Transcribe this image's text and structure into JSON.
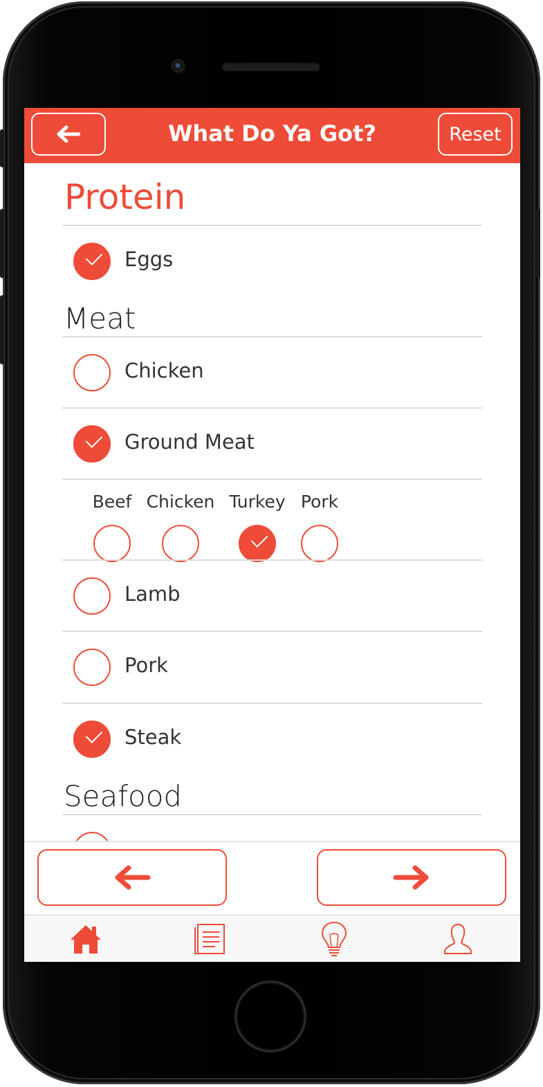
{
  "header": {
    "title": "What Do Ya Got?",
    "back_icon": "arrow-left-icon",
    "reset_label": "Reset"
  },
  "section": {
    "title": "Protein"
  },
  "items": {
    "eggs": {
      "label": "Eggs",
      "checked": true
    }
  },
  "meat": {
    "title": "Meat",
    "items": [
      {
        "label": "Chicken",
        "checked": false
      },
      {
        "label": "Ground Meat",
        "checked": true
      },
      {
        "label": "Lamb",
        "checked": false
      },
      {
        "label": "Pork",
        "checked": false
      },
      {
        "label": "Steak",
        "checked": true
      }
    ],
    "ground_meat_options": [
      {
        "label": "Beef",
        "checked": false
      },
      {
        "label": "Chicken",
        "checked": false
      },
      {
        "label": "Turkey",
        "checked": true
      },
      {
        "label": "Pork",
        "checked": false
      }
    ]
  },
  "seafood": {
    "title": "Seafood"
  },
  "pager": {
    "prev_icon": "arrow-left-icon",
    "next_icon": "arrow-right-icon"
  },
  "tabs": [
    {
      "icon": "home-icon",
      "active": true
    },
    {
      "icon": "list-icon",
      "active": false
    },
    {
      "icon": "lightbulb-icon",
      "active": false
    },
    {
      "icon": "user-icon",
      "active": false
    }
  ],
  "colors": {
    "accent": "#ee4b38",
    "frame": "#000000",
    "rule": "#dcdcdc"
  }
}
